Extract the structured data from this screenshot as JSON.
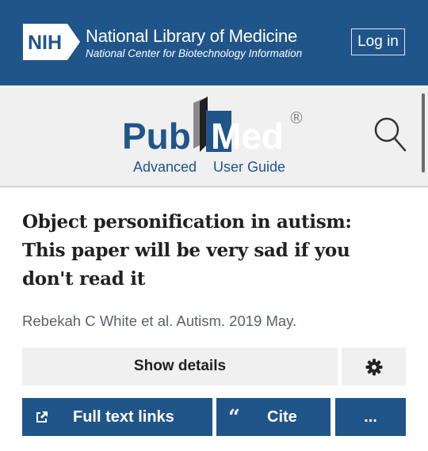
{
  "header": {
    "logo_text": "NIH",
    "title": "National Library of Medicine",
    "subtitle": "National Center for Biotechnology Information",
    "login_label": "Log in"
  },
  "pubmed": {
    "logo_left": "Pub",
    "logo_right": "Med",
    "registered_mark": "®",
    "advanced_label": "Advanced",
    "user_guide_label": "User Guide"
  },
  "article": {
    "title_lines": [
      "Object personification in autism:",
      "This paper will be very sad if you",
      "don't read it"
    ],
    "meta": "Rebekah C White et al. Autism. 2019 May."
  },
  "actions": {
    "show_details_label": "Show details",
    "full_text_label": "Full text links",
    "cite_label": "Cite",
    "cite_quote_glyph": "“",
    "more_label": "..."
  },
  "colors": {
    "brand_blue": "#20558a",
    "band_gray": "#f0f0f0",
    "pubmed_dark": "#212121"
  },
  "icons": {
    "search": "search-icon",
    "settings": "gear-icon",
    "external_link": "external-link-icon"
  }
}
